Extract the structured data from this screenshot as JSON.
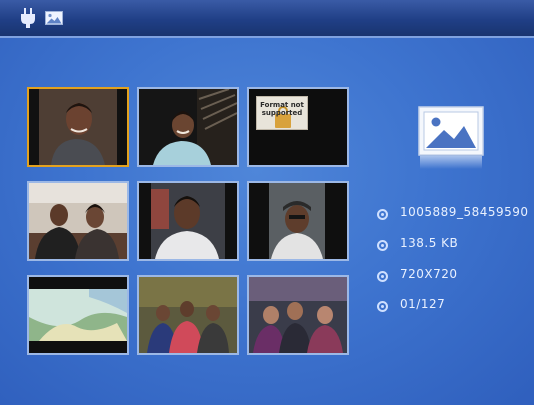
{
  "topbar": {
    "icons": [
      "plug-icon",
      "picture-icon"
    ]
  },
  "grid": {
    "thumbnails": [
      {
        "name": "thumbnail-1",
        "selected": true
      },
      {
        "name": "thumbnail-2",
        "selected": false
      },
      {
        "name": "thumbnail-3",
        "selected": false,
        "badge_line1": "Format not",
        "badge_line2": "supported"
      },
      {
        "name": "thumbnail-4",
        "selected": false
      },
      {
        "name": "thumbnail-5",
        "selected": false
      },
      {
        "name": "thumbnail-6",
        "selected": false
      },
      {
        "name": "thumbnail-7",
        "selected": false
      },
      {
        "name": "thumbnail-8",
        "selected": false
      },
      {
        "name": "thumbnail-9",
        "selected": false
      }
    ]
  },
  "info": {
    "file_type_icon": "image-file-icon",
    "filename": "1005889_58459590",
    "size": "138.5  KB",
    "resolution": "720X720",
    "index": "01/127"
  },
  "colors": {
    "background": "#3e74cf",
    "topbar": "#203f86",
    "selection_border": "#e3a21f",
    "thumb_border": "#9cb8e6",
    "info_text": "#e9f1ff"
  }
}
